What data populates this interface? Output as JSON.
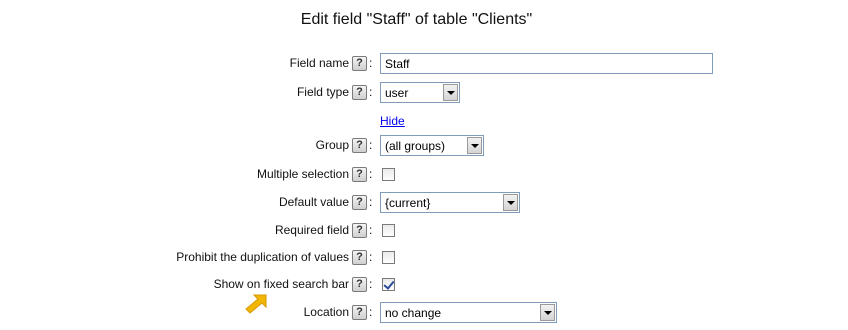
{
  "title": "Edit field \"Staff\" of table \"Clients\"",
  "help_glyph": "?",
  "colon": ":",
  "fields": {
    "field_name": {
      "label": "Field name",
      "value": "Staff"
    },
    "field_type": {
      "label": "Field type",
      "selected": "user",
      "options": [
        "user"
      ]
    },
    "hide_link": "Hide",
    "group": {
      "label": "Group",
      "selected": "(all groups)"
    },
    "multiple_selection": {
      "label": "Multiple selection",
      "checked": false
    },
    "default_value": {
      "label": "Default value",
      "selected": "{current}"
    },
    "required_field": {
      "label": "Required field",
      "checked": false
    },
    "prohibit_duplication": {
      "label": "Prohibit the duplication of values",
      "checked": false
    },
    "show_on_search_bar": {
      "label": "Show on fixed search bar",
      "checked": true
    },
    "location": {
      "label": "Location",
      "selected": "no change"
    }
  },
  "colors": {
    "input_border": "#7f9db9",
    "link": "#0000ee",
    "pointer_arrow": "#f2b705"
  },
  "icons": {
    "help": "help-icon",
    "dropdown": "chevron-down-icon",
    "pointer": "arrow-pointer-icon"
  }
}
